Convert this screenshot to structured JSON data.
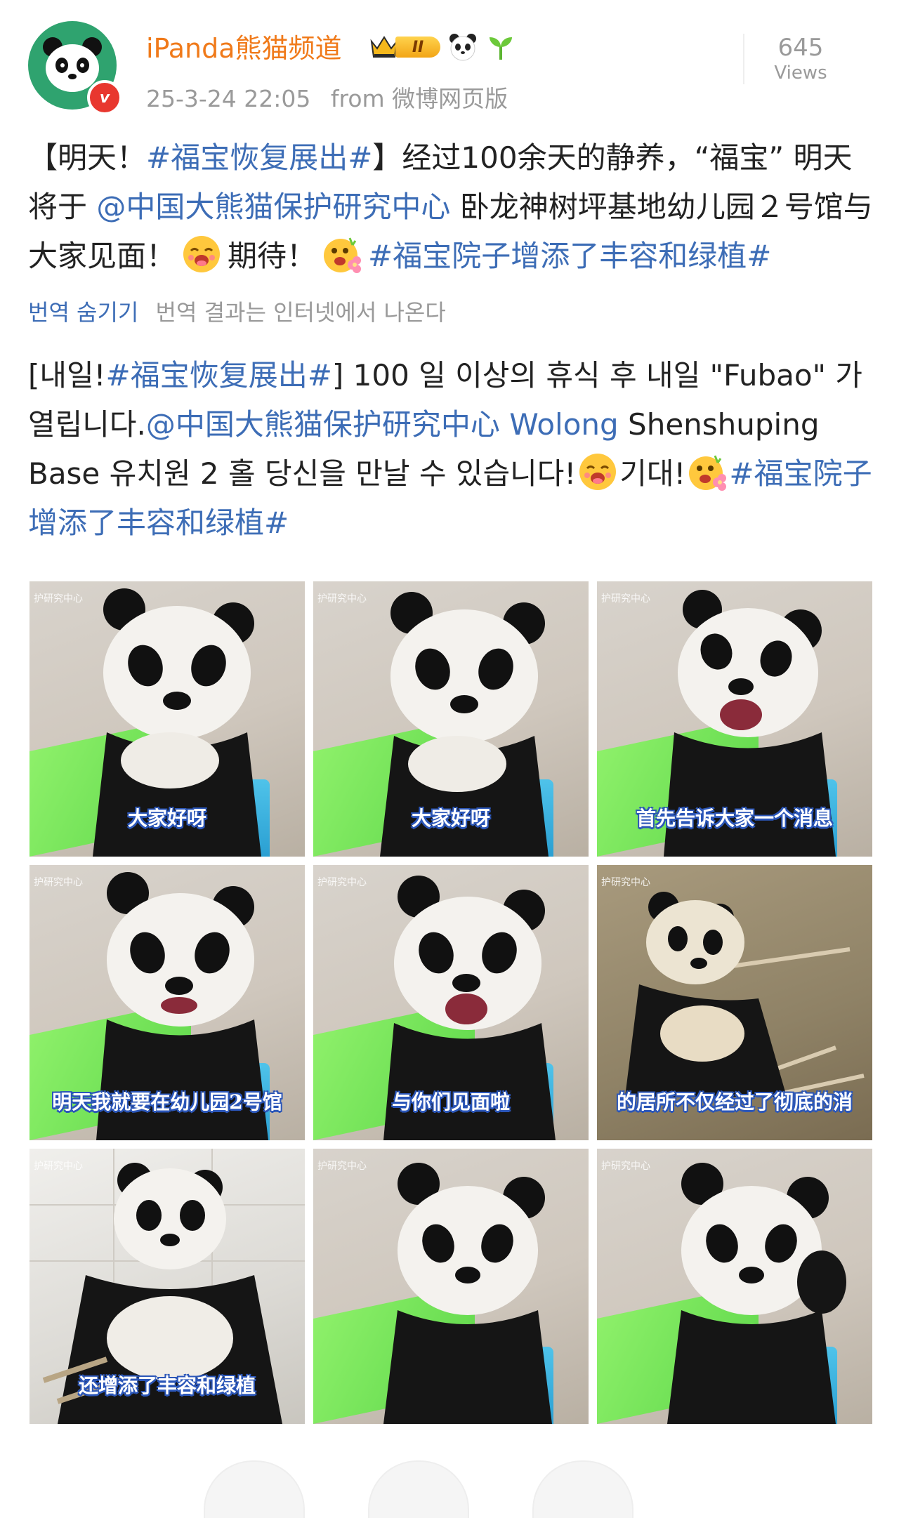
{
  "header": {
    "username": "iPanda熊猫频道",
    "rank_badge": "II",
    "verified_mark": "v",
    "date": "25-3-24 22:05",
    "source": "from 微博网页版",
    "views_count": "645",
    "views_label": "Views"
  },
  "post": {
    "p1": "【明天！",
    "tag1": "#福宝恢复展出#",
    "p2": "】经过100余天的静养，“福宝” 明天将于",
    "mention": "@中国大熊猫保护研究中心",
    "p3": " 卧龙神树坪基地幼儿园２号馆与大家见面！",
    "p4": "期待！",
    "tag2": "#福宝院子增添了丰容和绿植#"
  },
  "translate": {
    "hide_label": "번역 숨기기",
    "note": "번역 결과는 인터넷에서 나온다"
  },
  "translated": {
    "p1": "[내일!",
    "tag1": "#福宝恢复展出#",
    "p2": "] 100 일 이상의 휴식 후 내일 \"Fubao\" 가 열립니다.",
    "mention": "@中国大熊猫保护研究中心 Wolong",
    "p3": " Shenshuping Base 유치원 2 홀 당신을 만날 수 있습니다!",
    "p4": "기대!",
    "tag2": "#福宝院子增添了丰容和绿植#"
  },
  "photos": [
    {
      "caption": "大家好呀",
      "watermark": "护研究中心"
    },
    {
      "caption": "大家好呀",
      "watermark": "护研究中心"
    },
    {
      "caption": "首先告诉大家一个消息",
      "watermark": "护研究中心"
    },
    {
      "caption": "明天我就要在幼儿园2号馆",
      "watermark": "护研究中心"
    },
    {
      "caption": "与你们见面啦",
      "watermark": "护研究中心"
    },
    {
      "caption": "的居所不仅经过了彻底的消",
      "watermark": "护研究中心"
    },
    {
      "caption": "还增添了丰容和绿植",
      "watermark": "护研究中心"
    },
    {
      "caption": "",
      "watermark": "护研究中心"
    },
    {
      "caption": "",
      "watermark": "护研究中心"
    }
  ],
  "icons": {
    "avatar": "panda-logo-icon",
    "crown": "crown-icon",
    "panda_emoji": "panda-face-icon",
    "sprout_emoji": "seedling-icon",
    "yum_emoji": "yum-face-icon",
    "flower_emoji": "flower-face-icon"
  },
  "colors": {
    "username": "#f07a1a",
    "link": "#3d6db6",
    "meta": "#9a9a9a",
    "verified": "#e8372f",
    "avatar_bg": "#2fa36f",
    "caption_outline": "#2b56b8"
  }
}
